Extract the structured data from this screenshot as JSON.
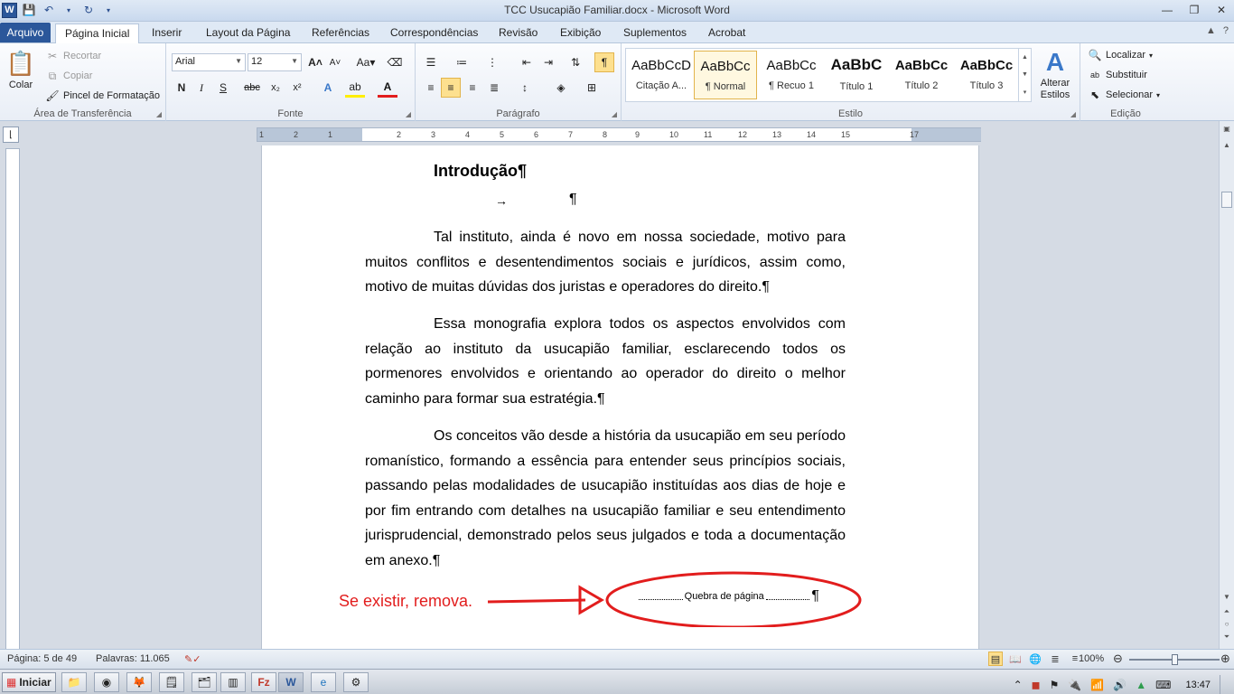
{
  "window": {
    "title": "TCC Usucapião Familiar.docx - Microsoft Word"
  },
  "tabs": [
    "Arquivo",
    "Página Inicial",
    "Inserir",
    "Layout da Página",
    "Referências",
    "Correspondências",
    "Revisão",
    "Exibição",
    "Suplementos",
    "Acrobat"
  ],
  "clipboard": {
    "paste": "Colar",
    "cut": "Recortar",
    "copy": "Copiar",
    "format_painter": "Pincel de Formatação",
    "label": "Área de Transferência"
  },
  "font": {
    "name": "Arial",
    "size": "12",
    "label": "Fonte",
    "bold": "N",
    "italic": "I",
    "underline": "S",
    "strike": "abc",
    "sub": "x₂",
    "sup": "x²",
    "grow": "A",
    "shrink": "A",
    "case": "Aa"
  },
  "paragraph": {
    "label": "Parágrafo",
    "pilcrow": "¶"
  },
  "styles": {
    "label": "Estilo",
    "items": [
      {
        "sample": "AaBbCcD",
        "name": "Citação A..."
      },
      {
        "sample": "AaBbCc",
        "name": "¶ Normal"
      },
      {
        "sample": "AaBbCc",
        "name": "¶ Recuo 1"
      },
      {
        "sample": "AaBbC",
        "name": "Título 1"
      },
      {
        "sample": "AaBbCc",
        "name": "Título 2"
      },
      {
        "sample": "AaBbCc",
        "name": "Título 3"
      }
    ],
    "change_styles": "Alterar Estilos"
  },
  "editing": {
    "label": "Edição",
    "find": "Localizar",
    "replace": "Substituir",
    "select": "Selecionar"
  },
  "ruler": {
    "ticks": [
      "1",
      "2",
      "1",
      "2",
      "3",
      "4",
      "5",
      "6",
      "7",
      "8",
      "9",
      "10",
      "11",
      "12",
      "13",
      "14",
      "15",
      "17"
    ]
  },
  "document": {
    "heading": "Introdução¶",
    "tab_arrow": "→",
    "empty_pilcrow": "¶",
    "paragraphs": [
      "Tal instituto, ainda é novo em nossa sociedade, motivo para muitos conflitos e desentendimentos sociais e jurídicos, assim como, motivo de muitas dúvidas dos juristas e operadores do direito.¶",
      "Essa monografia explora todos os aspectos envolvidos com relação ao instituto da usucapião familiar, esclarecendo todos os pormenores envolvidos e orientando ao operador do direito o melhor caminho para formar sua estratégia.¶",
      "Os conceitos vão desde a história da usucapião em seu período romanístico, formando a essência para entender seus princípios sociais, passando pelas modalidades de usucapião instituídas aos dias de hoje e por fim entrando com detalhes na usucapião familiar e seu entendimento jurisprudencial, demonstrado pelos seus julgados e toda a documentação em anexo.¶"
    ],
    "page_break": "Quebra de página",
    "page_break_pilcrow": "¶"
  },
  "annotation": {
    "text": "Se existir, remova.",
    "color": "#e21d1d"
  },
  "status": {
    "page": "Página: 5 de 49",
    "words": "Palavras: 11.065",
    "zoom": "100%",
    "zoom_fraction": 0.5
  },
  "taskbar": {
    "start": "Iniciar",
    "clock": "13:47"
  },
  "colors": {
    "accent": "#2b579a",
    "highlight": "#fde08f"
  }
}
